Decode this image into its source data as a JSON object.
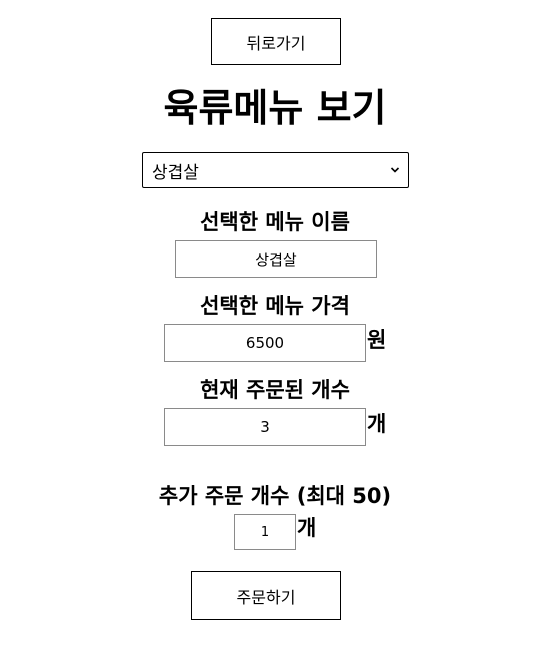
{
  "back_button": {
    "label": "뒤로가기"
  },
  "page_title": "육류메뉴 보기",
  "menu_select": {
    "selected": "상겹살"
  },
  "selected_name": {
    "label": "선택한 메뉴 이름",
    "value": "상겹살"
  },
  "selected_price": {
    "label": "선택한 메뉴 가격",
    "value": "6500",
    "unit": "원"
  },
  "current_count": {
    "label": "현재 주문된 개수",
    "value": "3",
    "unit": "개"
  },
  "add_count": {
    "label": "추가 주문 개수 (최대 50)",
    "value": "1",
    "unit": "개"
  },
  "order_button": {
    "label": "주문하기"
  },
  "icons": {
    "select_arrow": "chevron-down-icon"
  }
}
